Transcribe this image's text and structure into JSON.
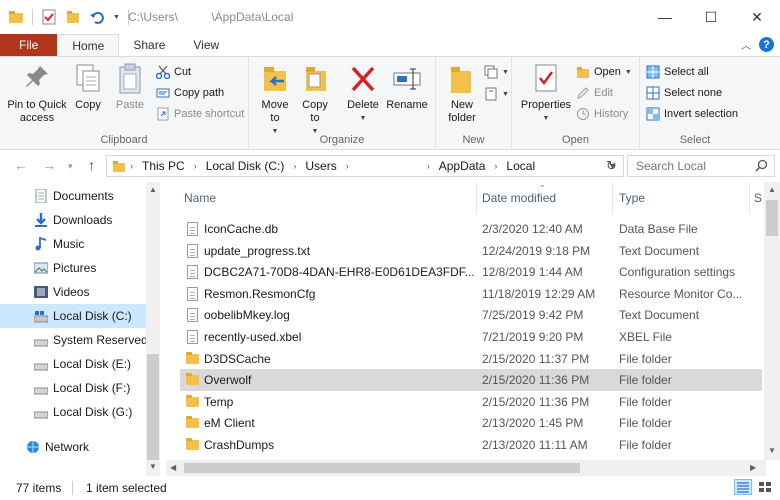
{
  "window": {
    "title_path": "C:\\Users\\          \\AppData\\Local",
    "controls": [
      "minimize",
      "maximize",
      "close"
    ],
    "control_glyphs": {
      "minimize": "—",
      "maximize": "☐",
      "close": "✕"
    }
  },
  "tabs": [
    {
      "label": "File"
    },
    {
      "label": "Home"
    },
    {
      "label": "Share"
    },
    {
      "label": "View"
    }
  ],
  "ribbon": {
    "clipboard": {
      "label": "Clipboard",
      "pin": "Pin to Quick\naccess",
      "copy": "Copy",
      "paste": "Paste",
      "cut": "Cut",
      "copy_path": "Copy path",
      "paste_shortcut": "Paste shortcut"
    },
    "organize": {
      "label": "Organize",
      "move_to": "Move\nto",
      "copy_to": "Copy\nto",
      "delete": "Delete",
      "rename": "Rename"
    },
    "new": {
      "label": "New",
      "new_folder": "New\nfolder"
    },
    "open": {
      "label": "Open",
      "properties": "Properties",
      "open": "Open",
      "edit": "Edit",
      "history": "History"
    },
    "select": {
      "label": "Select",
      "select_all": "Select all",
      "select_none": "Select none",
      "invert": "Invert selection"
    }
  },
  "address": {
    "crumbs": [
      "This PC",
      "Local Disk (C:)",
      "Users",
      "",
      "AppData",
      "Local"
    ],
    "search_placeholder": "Search Local"
  },
  "nav": [
    {
      "label": "Documents",
      "icon": "documents-icon",
      "selected": false
    },
    {
      "label": "Downloads",
      "icon": "downloads-icon",
      "selected": false
    },
    {
      "label": "Music",
      "icon": "music-icon",
      "selected": false
    },
    {
      "label": "Pictures",
      "icon": "pictures-icon",
      "selected": false
    },
    {
      "label": "Videos",
      "icon": "videos-icon",
      "selected": false
    },
    {
      "label": "Local Disk (C:)",
      "icon": "drive-icon",
      "selected": true
    },
    {
      "label": "System Reserved",
      "icon": "drive-icon",
      "selected": false
    },
    {
      "label": "Local Disk (E:)",
      "icon": "drive-icon",
      "selected": false
    },
    {
      "label": "Local Disk (F:)",
      "icon": "drive-icon",
      "selected": false
    },
    {
      "label": "Local Disk (G:)",
      "icon": "drive-icon",
      "selected": false
    },
    {
      "label": "Network",
      "icon": "network-icon",
      "selected": false
    }
  ],
  "columns": {
    "name": "Name",
    "date": "Date modified",
    "type": "Type",
    "size": "S"
  },
  "files": [
    {
      "name": "IconCache.db",
      "date": "2/3/2020 12:40 AM",
      "type": "Data Base File",
      "icon": "file-icon",
      "selected": false
    },
    {
      "name": "update_progress.txt",
      "date": "12/24/2019 9:18 PM",
      "type": "Text Document",
      "icon": "file-icon",
      "selected": false
    },
    {
      "name": "DCBC2A71-70D8-4DAN-EHR8-E0D61DEA3FDF...",
      "date": "12/8/2019 1:44 AM",
      "type": "Configuration settings",
      "icon": "settings-file-icon",
      "selected": false
    },
    {
      "name": "Resmon.ResmonCfg",
      "date": "11/18/2019 12:29 AM",
      "type": "Resource Monitor Co...",
      "icon": "monitor-file-icon",
      "selected": false
    },
    {
      "name": "oobelibMkey.log",
      "date": "7/25/2019 9:42 PM",
      "type": "Text Document",
      "icon": "file-icon",
      "selected": false
    },
    {
      "name": "recently-used.xbel",
      "date": "7/21/2019 9:20 PM",
      "type": "XBEL File",
      "icon": "file-icon",
      "selected": false
    },
    {
      "name": "D3DSCache",
      "date": "2/15/2020 11:37 PM",
      "type": "File folder",
      "icon": "folder-icon",
      "selected": false
    },
    {
      "name": "Overwolf",
      "date": "2/15/2020 11:36 PM",
      "type": "File folder",
      "icon": "folder-icon",
      "selected": true
    },
    {
      "name": "Temp",
      "date": "2/15/2020 11:36 PM",
      "type": "File folder",
      "icon": "folder-icon",
      "selected": false
    },
    {
      "name": "eM Client",
      "date": "2/13/2020 1:45 PM",
      "type": "File folder",
      "icon": "folder-icon",
      "selected": false
    },
    {
      "name": "CrashDumps",
      "date": "2/13/2020 11:11 AM",
      "type": "File folder",
      "icon": "folder-icon",
      "selected": false
    }
  ],
  "status": {
    "items": "77 items",
    "selected": "1 item selected"
  },
  "colors": {
    "file_tab": "#b0361a",
    "selected_row": "#d9d9d9",
    "nav_selected": "#cce8ff",
    "folder": "#f3c049",
    "accent_blue": "#1a73d9"
  }
}
